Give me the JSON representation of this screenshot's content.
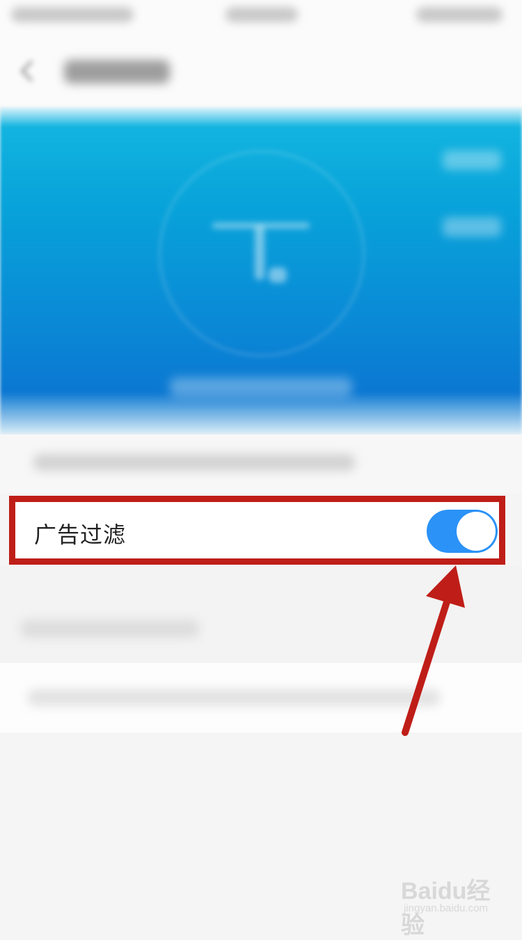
{
  "settings": {
    "ad_filter": {
      "label": "广告过滤",
      "enabled": true
    }
  },
  "colors": {
    "hero_blue": "#0a8ad6",
    "toggle_on": "#2b92f7",
    "annotation_red": "#bf1e18"
  },
  "watermark": {
    "brand": "Baidu经验",
    "sub": "jingyan.baidu.com"
  },
  "icons": [
    "back-arrow-icon",
    "annotation-arrow"
  ]
}
